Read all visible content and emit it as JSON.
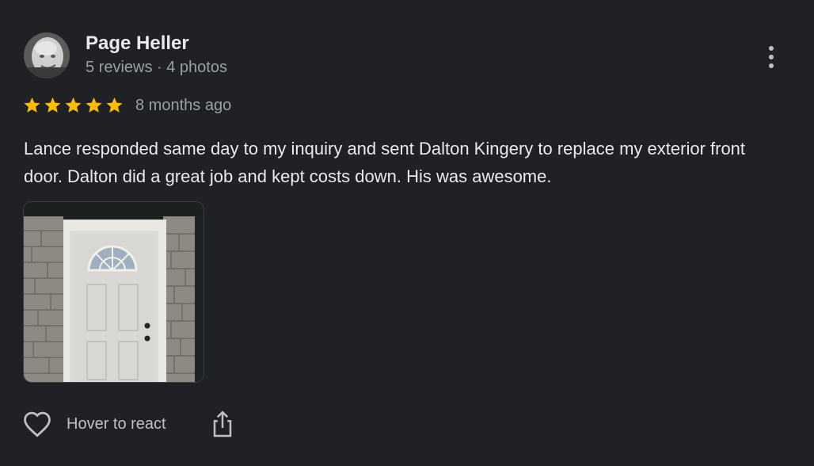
{
  "review": {
    "author": {
      "name": "Page Heller",
      "meta": "5 reviews · 4 photos",
      "avatar_icon": "user-avatar-photo"
    },
    "rating": {
      "stars": 5,
      "max_stars": 5,
      "date": "8 months ago",
      "star_color": "#fbbc04"
    },
    "text": "Lance responded same day to my inquiry and sent Dalton Kingery to replace my exterior front door. Dalton did a great job and kept costs down. His was awesome.",
    "photos": [
      {
        "icon": "front-door-photo"
      }
    ],
    "actions": {
      "react_label": "Hover to react",
      "react_icon": "heart-icon",
      "share_icon": "share-icon",
      "menu_icon": "more-vert-icon"
    }
  }
}
